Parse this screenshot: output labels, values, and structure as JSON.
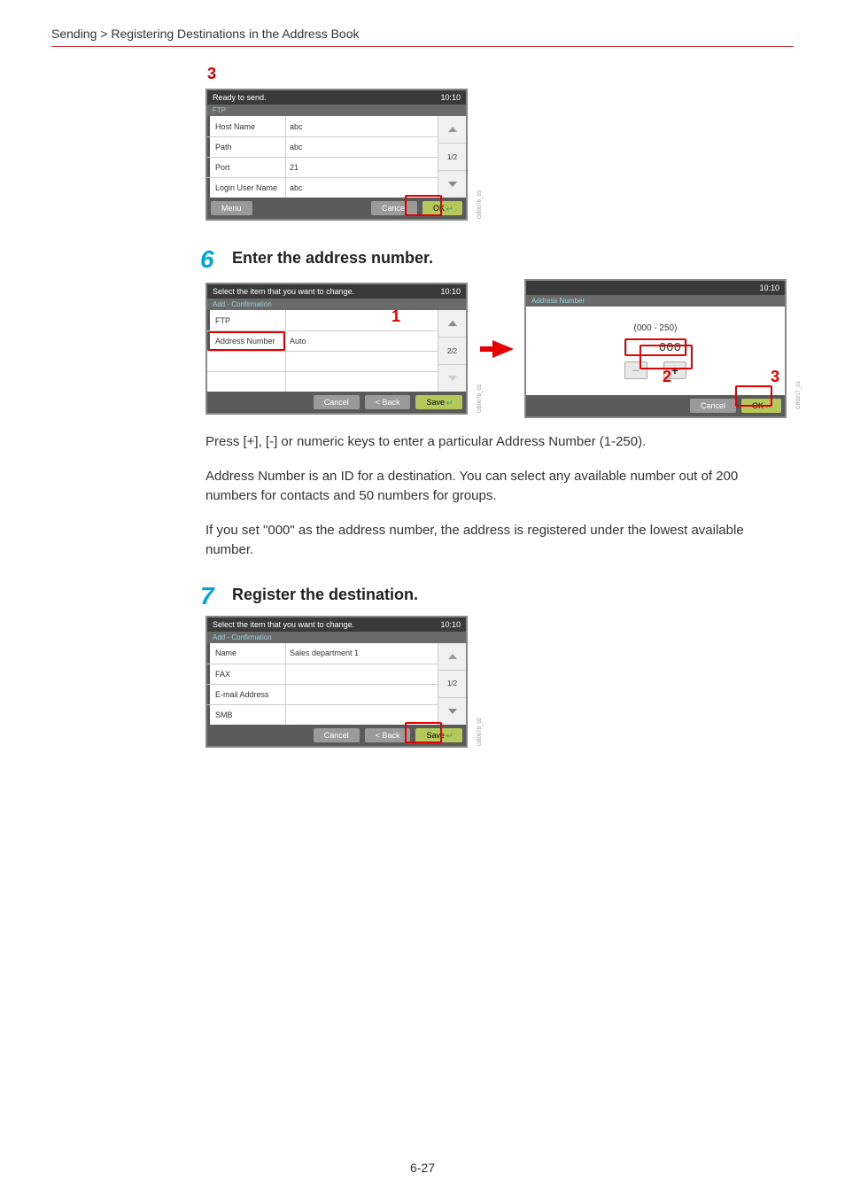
{
  "breadcrumb": "Sending > Registering Destinations in the Address Book",
  "page_number": "6-27",
  "step3": {
    "num": "3",
    "header": "Ready to send.",
    "time": "10:10",
    "subheader": "FTP",
    "rows": [
      {
        "label": "Host Name",
        "val": "abc"
      },
      {
        "label": "Path",
        "val": "abc"
      },
      {
        "label": "Port",
        "val": "21"
      },
      {
        "label": "Login User Name",
        "val": "abc"
      }
    ],
    "page": "1/2",
    "menu": "Menu",
    "cancel": "Cancel",
    "ok": "OK",
    "caption": "GB0078_03"
  },
  "step6": {
    "num": "6",
    "title": "Enter the address number.",
    "panelA": {
      "header": "Select the item that you want to change.",
      "time": "10:10",
      "subheader": "Add - Confirmation",
      "rows": [
        {
          "label": "FTP",
          "val": ""
        },
        {
          "label": "Address Number",
          "val": "Auto"
        }
      ],
      "page": "2/2",
      "cancel": "Cancel",
      "back": "< Back",
      "save": "Save",
      "caption": "GB0078_03",
      "mark": "1"
    },
    "panelB": {
      "time": "10:10",
      "subheader": "Address Number",
      "range": "(000 - 250)",
      "display": "000",
      "cancel": "Cancel",
      "ok": "OK",
      "caption": "GB0217_01",
      "mark2": "2",
      "mark3": "3"
    },
    "body1": "Press [+], [-] or numeric keys to enter a particular Address Number (1-250).",
    "body2": "Address Number is an ID for a destination. You can select any available number out of 200 numbers for contacts and 50 numbers for groups.",
    "body3": "If you set \"000\" as the address number, the address is registered under the lowest available number."
  },
  "step7": {
    "num": "7",
    "title": "Register the destination.",
    "header": "Select the item that you want to change.",
    "time": "10:10",
    "subheader": "Add - Confirmation",
    "rows": [
      {
        "label": "Name",
        "val": "Sales department 1"
      },
      {
        "label": "FAX",
        "val": ""
      },
      {
        "label": "E-mail Address",
        "val": ""
      },
      {
        "label": "SMB",
        "val": ""
      }
    ],
    "page": "1/2",
    "cancel": "Cancel",
    "back": "< Back",
    "save": "Save",
    "caption": "GB0078_02"
  }
}
